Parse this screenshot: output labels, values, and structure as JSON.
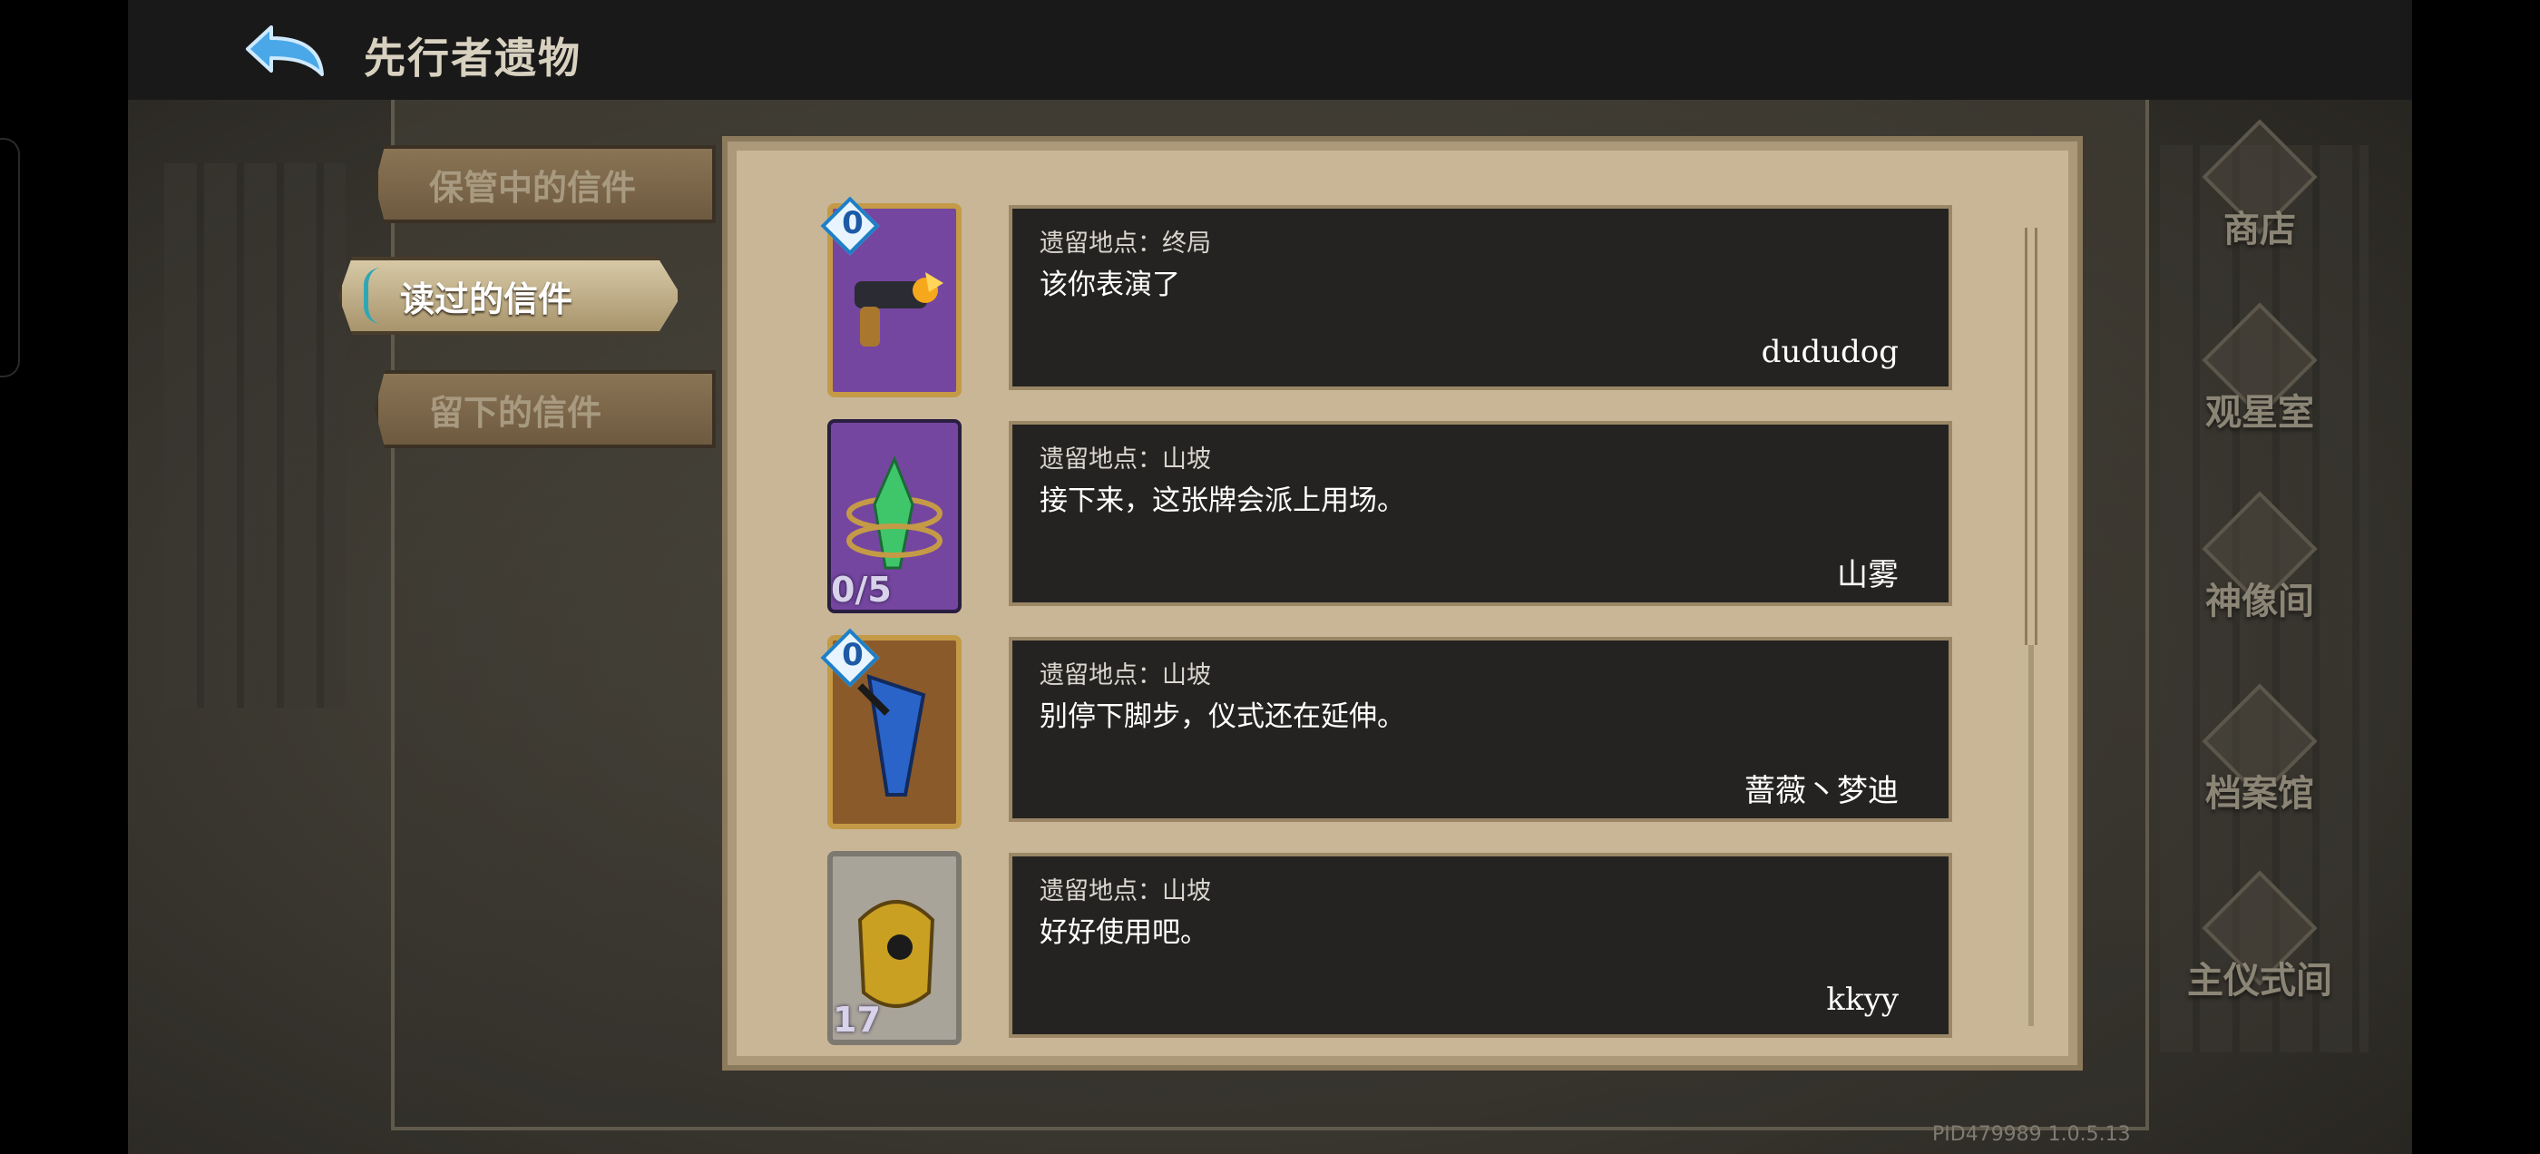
{
  "header": {
    "title": "先行者遗物"
  },
  "tabs": [
    {
      "label": "保管中的信件",
      "active": false
    },
    {
      "label": "读过的信件",
      "active": true
    },
    {
      "label": "留下的信件",
      "active": false
    }
  ],
  "letters": [
    {
      "location": "遗留地点：终局",
      "text": "该你表演了",
      "author": "dududog",
      "card_cost": "0",
      "card_style": "purple"
    },
    {
      "location": "遗留地点：山坡",
      "text": "接下来，这张牌会派上用场。",
      "author": "山雾",
      "card_count": "0/5",
      "card_style": "crystal"
    },
    {
      "location": "遗留地点：山坡",
      "text": "别停下脚步，仪式还在延伸。",
      "author": "蔷薇丶梦迪",
      "card_cost": "0",
      "card_style": "brown"
    },
    {
      "location": "遗留地点：山坡",
      "text": "好好使用吧。",
      "author": "kkyy",
      "card_count": "17",
      "card_style": "grey"
    }
  ],
  "nav": [
    {
      "label": "商店",
      "icon": "shop-icon"
    },
    {
      "label": "观星室",
      "icon": "observatory-icon"
    },
    {
      "label": "神像间",
      "icon": "statue-room-icon"
    },
    {
      "label": "档案馆",
      "icon": "archive-icon"
    },
    {
      "label": "主仪式间",
      "icon": "ritual-room-icon"
    }
  ],
  "version": "PID479989  1.0.5.13",
  "colors": {
    "accent_teal": "#2ea7b4",
    "gem_blue": "#1d7fc6",
    "panel_parchment": "#c8b697",
    "message_bg": "#252321"
  }
}
